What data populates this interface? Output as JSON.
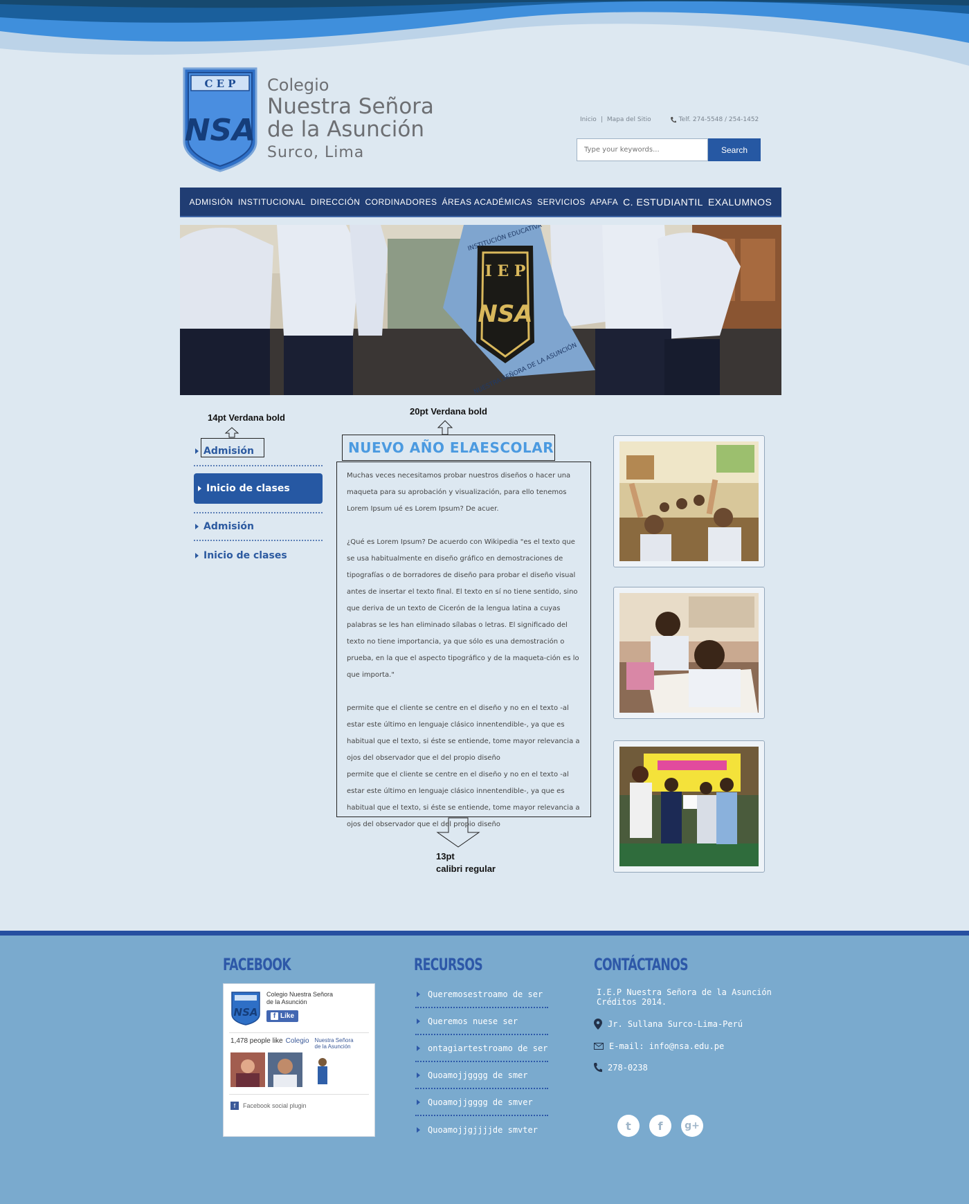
{
  "header": {
    "logo": {
      "line1": "Colegio",
      "line2": "Nuestra Señora",
      "line3": "de la Asunción",
      "line4": "Surco, Lima",
      "shield_top": "C E P",
      "shield_mono": "NSA"
    },
    "toplinks": {
      "inicio": "Inicio",
      "sep": "|",
      "mapa": "Mapa del Sitio",
      "phone": "Telf. 274-5548 / 254-1452"
    },
    "search": {
      "placeholder": "Type your keywords...",
      "button": "Search"
    }
  },
  "nav": [
    "ADMISIÓN",
    "INSTITUCIONAL",
    "DIRECCIÓN",
    "CORDINADORES",
    "ÁREAS ACADÉMICAS",
    "SERVICIOS",
    "APAFA",
    "C. ESTUDIANTIL",
    "EXALUMNOS"
  ],
  "hero": {
    "banner_iep": "I E P",
    "banner_mono": "NSA",
    "banner_top": "INSTITUCIÓN EDUCATIVA",
    "banner_bottom": "NUESTRA SEÑORA DE LA ASUNCIÓN"
  },
  "annotations": {
    "sidebar_font": "14pt Verdana bold",
    "title_font": "20pt Verdana bold",
    "body_font_size": "13pt",
    "body_font_name": "calibri regular"
  },
  "sidebar": [
    {
      "label": "Admisión",
      "active": false
    },
    {
      "label": "Inicio de clases",
      "active": true
    },
    {
      "label": "Admisión",
      "active": false
    },
    {
      "label": "Inicio de clases",
      "active": false
    }
  ],
  "article": {
    "title": "NUEVO AÑO ELAESCOLAR",
    "p1": "Muchas veces necesitamos probar nuestros diseños o hacer una maqueta para su aprobación y visualización, para ello tenemos Lorem Ipsum ué es Lorem Ipsum? De acuer.",
    "p2": "¿Qué es Lorem Ipsum? De acuerdo con Wikipedia \"es el texto que se usa habitualmente en diseño gráfico en demostraciones de tipografías o de borradores de diseño para probar el diseño visual antes de insertar el texto final. El texto en sí no tiene sentido, sino que deriva de un texto de Cicerón de la lengua latina a cuyas palabras se les han eliminado sílabas o letras. El significado del texto no tiene importancia, ya que sólo es una demostración o prueba, en la que el aspecto tipográfico y de la maqueta-ción es lo que importa.\"",
    "p3": "permite que el cliente se centre en el diseño y no en el texto -al estar este último en lenguaje clásico innentendible-, ya que es habitual que el texto, si éste se entiende, tome mayor relevancia a ojos del observador que el del propio diseño",
    "p4": "permite que el cliente se centre en el diseño y no en el texto -al estar este último en lenguaje clásico innentendible-, ya que es habitual que el texto, si éste se entiende, tome mayor relevancia a ojos del observador que el del propio diseño"
  },
  "footer": {
    "facebook": {
      "heading": "FACEBOOK",
      "page_name_1": "Colegio Nuestra Señora",
      "page_name_2": "de la Asunción",
      "like": "Like",
      "count_text": "1,478 people like",
      "count_link_1": "Colegio",
      "count_link_2": "Nuestra Señora",
      "count_link_3": "de la Asunción",
      "plugin": "Facebook social plugin"
    },
    "recursos": {
      "heading": "RECURSOS",
      "items": [
        "Queremosestroamo de ser",
        "Queremos nuese ser",
        "ontagiartestroamo de ser",
        "Quoamojjgggg de smer",
        "Quoamojjgggg de smver",
        "Quoamojjgjjjjde smvter"
      ]
    },
    "contacto": {
      "heading": "CONTÁCTANOS",
      "org_1": "I.E.P Nuestra Señora de la Asunción",
      "org_2": "Créditos   2014.",
      "address": "Jr. Sullana Surco-Lima-Perú",
      "email": "E-mail: info@nsa.edu.pe",
      "phone": "278-0238"
    },
    "social": {
      "twitter": "t",
      "facebook": "f",
      "google": "g+"
    }
  },
  "colors": {
    "nav_bg": "#203d73",
    "accent": "#2658a3",
    "title": "#4b9ae0",
    "footer_bg": "#7aaace",
    "footer_heading": "#2d58a8"
  }
}
